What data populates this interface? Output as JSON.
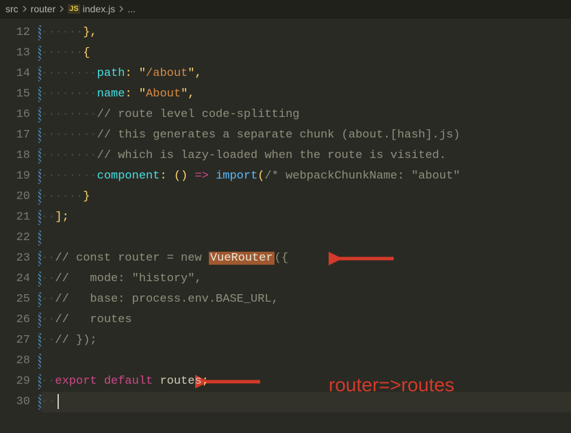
{
  "breadcrumb": {
    "parts": [
      "src",
      "router"
    ],
    "file": "index.js",
    "file_icon": "JS",
    "tail": "..."
  },
  "lines": [
    {
      "n": 12,
      "ws": "      ",
      "t": [
        {
          "c": "brace",
          "v": "}"
        },
        {
          "c": "punct",
          "v": ","
        }
      ]
    },
    {
      "n": 13,
      "ws": "      ",
      "t": [
        {
          "c": "brace",
          "v": "{"
        }
      ]
    },
    {
      "n": 14,
      "ws": "        ",
      "t": [
        {
          "c": "key",
          "v": "path"
        },
        {
          "c": "punct",
          "v": ": "
        },
        {
          "c": "quote",
          "v": "\""
        },
        {
          "c": "str",
          "v": "/about"
        },
        {
          "c": "quote",
          "v": "\""
        },
        {
          "c": "punct",
          "v": ","
        }
      ]
    },
    {
      "n": 15,
      "ws": "        ",
      "t": [
        {
          "c": "key",
          "v": "name"
        },
        {
          "c": "punct",
          "v": ": "
        },
        {
          "c": "quote",
          "v": "\""
        },
        {
          "c": "str",
          "v": "About"
        },
        {
          "c": "quote",
          "v": "\""
        },
        {
          "c": "punct",
          "v": ","
        }
      ]
    },
    {
      "n": 16,
      "ws": "        ",
      "t": [
        {
          "c": "cmt",
          "v": "// route level code-splitting"
        }
      ]
    },
    {
      "n": 17,
      "ws": "        ",
      "t": [
        {
          "c": "cmt",
          "v": "// this generates a separate chunk (about.[hash].js)"
        }
      ]
    },
    {
      "n": 18,
      "ws": "        ",
      "t": [
        {
          "c": "cmt",
          "v": "// which is lazy-loaded when the route is visited."
        }
      ]
    },
    {
      "n": 19,
      "ws": "        ",
      "t": [
        {
          "c": "key",
          "v": "component"
        },
        {
          "c": "punct",
          "v": ": "
        },
        {
          "c": "brace",
          "v": "()"
        },
        {
          "c": "ident",
          "v": " "
        },
        {
          "c": "arrow",
          "v": "=>"
        },
        {
          "c": "ident",
          "v": " "
        },
        {
          "c": "fn",
          "v": "import"
        },
        {
          "c": "brace",
          "v": "("
        },
        {
          "c": "cmt",
          "v": "/* webpackChunkName: \"about\""
        }
      ]
    },
    {
      "n": 20,
      "ws": "      ",
      "t": [
        {
          "c": "brace",
          "v": "}"
        }
      ]
    },
    {
      "n": 21,
      "ws": "  ",
      "t": [
        {
          "c": "brace",
          "v": "]"
        },
        {
          "c": "punct",
          "v": ";"
        }
      ]
    },
    {
      "n": 22,
      "ws": "",
      "t": []
    },
    {
      "n": 23,
      "ws": "  ",
      "t": [
        {
          "c": "cmt",
          "v": "// const router = new "
        },
        {
          "c": "hl",
          "v": "VueRouter"
        },
        {
          "c": "cmt",
          "v": "({"
        }
      ]
    },
    {
      "n": 24,
      "ws": "  ",
      "t": [
        {
          "c": "cmt",
          "v": "//   mode: \"history\","
        }
      ]
    },
    {
      "n": 25,
      "ws": "  ",
      "t": [
        {
          "c": "cmt",
          "v": "//   base: process.env.BASE_URL,"
        }
      ]
    },
    {
      "n": 26,
      "ws": "  ",
      "t": [
        {
          "c": "cmt",
          "v": "//   routes"
        }
      ]
    },
    {
      "n": 27,
      "ws": "  ",
      "t": [
        {
          "c": "cmt",
          "v": "// });"
        }
      ]
    },
    {
      "n": 28,
      "ws": "",
      "t": []
    },
    {
      "n": 29,
      "ws": "  ",
      "t": [
        {
          "c": "kw",
          "v": "export"
        },
        {
          "c": "ident",
          "v": " "
        },
        {
          "c": "kw",
          "v": "default"
        },
        {
          "c": "ident",
          "v": " "
        },
        {
          "c": "ident",
          "v": "routes"
        },
        {
          "c": "punct",
          "v": ";"
        }
      ]
    },
    {
      "n": 30,
      "ws": "  ",
      "t": [],
      "active": true
    }
  ],
  "annotation": "router=>routes",
  "whitespace_dot": "·"
}
